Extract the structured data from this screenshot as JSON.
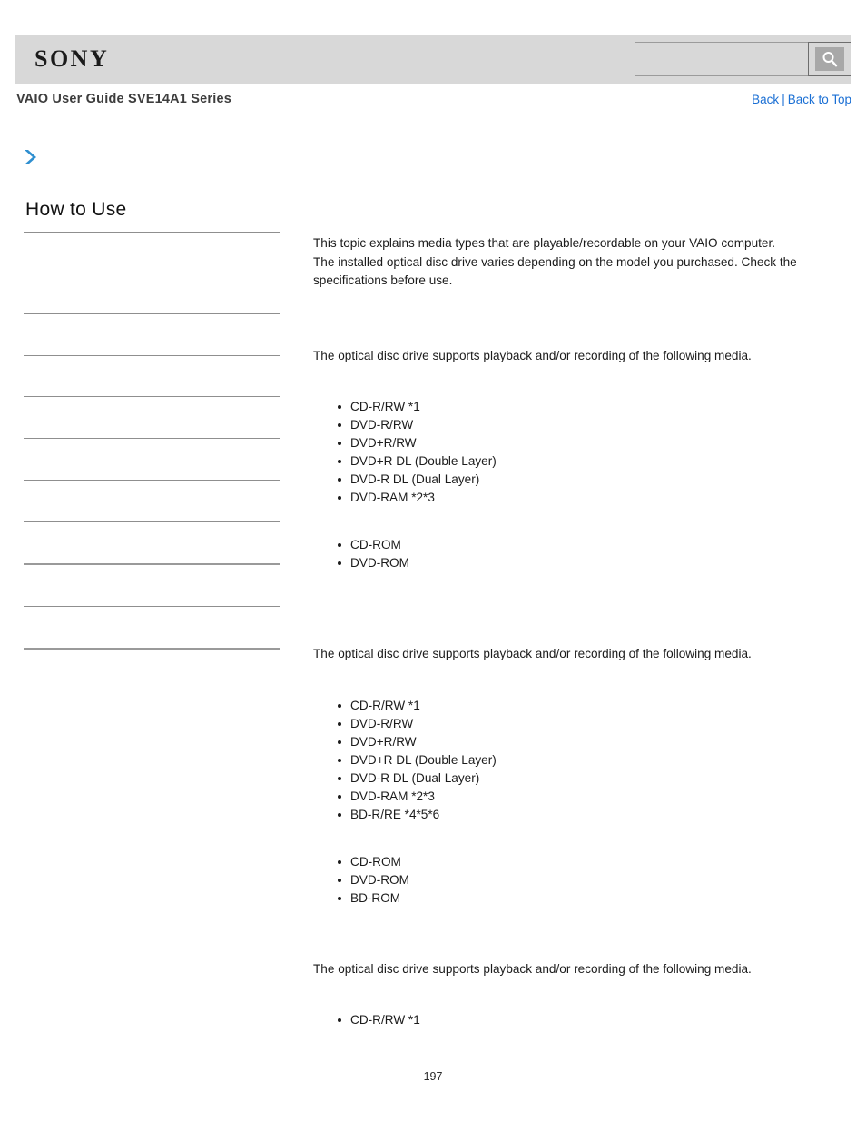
{
  "header": {
    "logo_text": "SONY",
    "guide_title": "VAIO User Guide SVE14A1 Series",
    "search": {
      "value": "",
      "placeholder": "",
      "button_icon": "search-icon"
    },
    "nav": {
      "back_label": "Back",
      "separator": "|",
      "back_to_top_label": "Back to Top"
    }
  },
  "breadcrumb_icon": "blue-chevron-right-icon",
  "sidebar": {
    "title": "How to Use",
    "items": [
      {
        "label": ""
      },
      {
        "label": ""
      },
      {
        "label": ""
      },
      {
        "label": ""
      },
      {
        "label": ""
      },
      {
        "label": ""
      },
      {
        "label": ""
      },
      {
        "label": ""
      },
      {
        "label": ""
      },
      {
        "label": ""
      },
      {
        "label": ""
      }
    ]
  },
  "main": {
    "intro": "This topic explains media types that are playable/recordable on your VAIO computer.\nThe installed optical disc drive varies depending on the model you purchased. Check the specifications before use.",
    "sections": [
      {
        "lead": "The optical disc drive supports playback and/or recording of the following media.",
        "recordable": [
          "CD-R/RW *1",
          "DVD-R/RW",
          "DVD+R/RW",
          "DVD+R DL (Double Layer)",
          "DVD-R DL (Dual Layer)",
          "DVD-RAM *2*3"
        ],
        "playback": [
          "CD-ROM",
          "DVD-ROM"
        ]
      },
      {
        "lead": "The optical disc drive supports playback and/or recording of the following media.",
        "recordable": [
          "CD-R/RW *1",
          "DVD-R/RW",
          "DVD+R/RW",
          "DVD+R DL (Double Layer)",
          "DVD-R DL (Dual Layer)",
          "DVD-RAM *2*3",
          "BD-R/RE *4*5*6"
        ],
        "playback": [
          "CD-ROM",
          "DVD-ROM",
          "BD-ROM"
        ]
      },
      {
        "lead": "The optical disc drive supports playback and/or recording of the following media.",
        "recordable": [
          "CD-R/RW *1"
        ],
        "playback": []
      }
    ]
  },
  "footer": {
    "page_number": "197"
  },
  "colors": {
    "header_band": "#d8d8d8",
    "link_blue": "#1a6fd4",
    "chevron_blue": "#2f8fd0",
    "rule_gray": "#8f8f8f"
  }
}
